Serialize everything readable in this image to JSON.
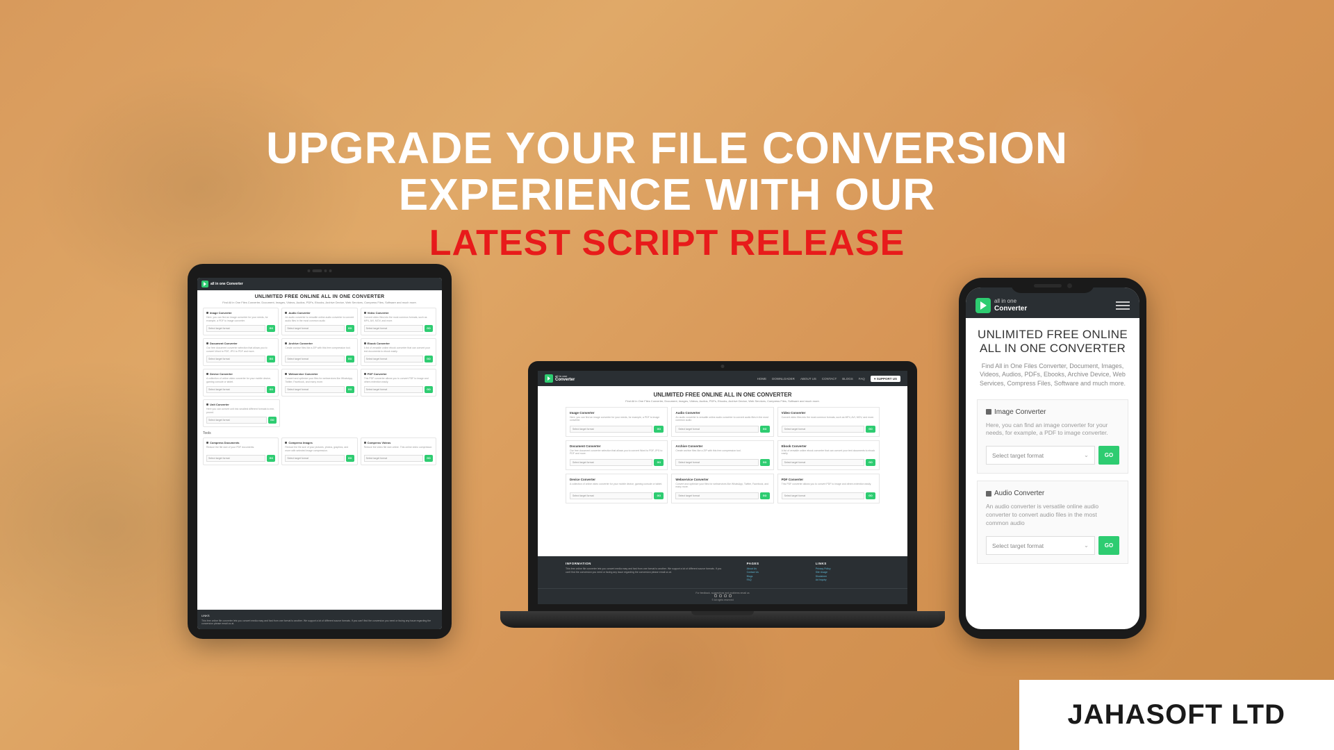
{
  "headline": {
    "line1": "UPGRADE YOUR FILE CONVERSION",
    "line2": "EXPERIENCE WITH OUR",
    "line3": "LATEST SCRIPT RELEASE"
  },
  "company": "JAHASOFT LTD",
  "brand": {
    "small": "all in one",
    "big": "Converter"
  },
  "app": {
    "title": "UNLIMITED FREE ONLINE ALL IN ONE CONVERTER",
    "subtitle": "Find All in One Files Converter, Document, Images, Videos, Audios, PDFs, Ebooks, Archive Device, Web Services, Compress Files, Software and much more.",
    "select_placeholder": "Select target format",
    "go": "GO"
  },
  "nav": {
    "home": "HOME",
    "downloader": "DOWNLOADER",
    "about": "ABOUT US",
    "contact": "CONTACT",
    "blogs": "BLOGS",
    "faq": "FAQ",
    "support": "♥ SUPPORT US"
  },
  "cards": {
    "image": {
      "title": "Image Converter",
      "desc": "Here, you can find an image converter for your needs, for example, a PDF to image converter."
    },
    "audio": {
      "title": "Audio Converter",
      "desc": "An audio converter is versatile online audio converter to convert audio files in the most common audio"
    },
    "video": {
      "title": "Video Converter",
      "desc": "Convert video files into the most common formats, such as MP4, AVI, MOV, and more."
    },
    "document": {
      "title": "Document Converter",
      "desc": "Our free document converter selection that allows you to convert Word to PDF, JPG to PDF and more."
    },
    "archive": {
      "title": "Archive Converter",
      "desc": "Create archive files like a ZIP with this free compression tool."
    },
    "ebook": {
      "title": "Ebook Converter",
      "desc": "A list of versatile online ebook converter that can convert your text documents to ebook easily."
    },
    "device": {
      "title": "Device Converter",
      "desc": "A collection of online video converter for your mobile device, gaming console or tablet."
    },
    "webservice": {
      "title": "Webservice Converter",
      "desc": "Convert and optimize your files for webservices like WhatsApp, Twitter, Facebook, and many more."
    },
    "pdf": {
      "title": "PDF Converter",
      "desc": "This PDF converter allows you to convert PDF to image and others extention easily."
    },
    "unit": {
      "title": "Unit Converter",
      "desc": "Here you can convert unit into smallest different formats to mm, pound."
    }
  },
  "tools": {
    "heading": "Tools",
    "compress_doc": {
      "title": "Compress Documents",
      "desc": "Reduce the file size of your PDF documents."
    },
    "compress_img": {
      "title": "Compress Images",
      "desc": "Reduce the file size of your pictures, photos, graphics, and more with selected image compression."
    },
    "compress_vid": {
      "title": "Compress Videos",
      "desc": "Reduce the video file size online. This online video compressor."
    }
  },
  "footer": {
    "info_h": "INFORMATION",
    "info_t": "This free online file converter lets you convert media easy and fast from one format to another. We support a lot of different source formats. If you can't find the conversion you need or facing any issue regarding the conversion please email us at.",
    "pages_h": "PAGES",
    "pages": [
      "About Us",
      "Contact Us",
      "Blogs",
      "FAQ"
    ],
    "links_h": "LINKS",
    "links": [
      "Privacy Policy",
      "Site Usage",
      "Disclaimer",
      "Ad Inquiry"
    ],
    "feedback": "For feedback, suggestions and problems email us",
    "rights": "© All rights reserved"
  }
}
